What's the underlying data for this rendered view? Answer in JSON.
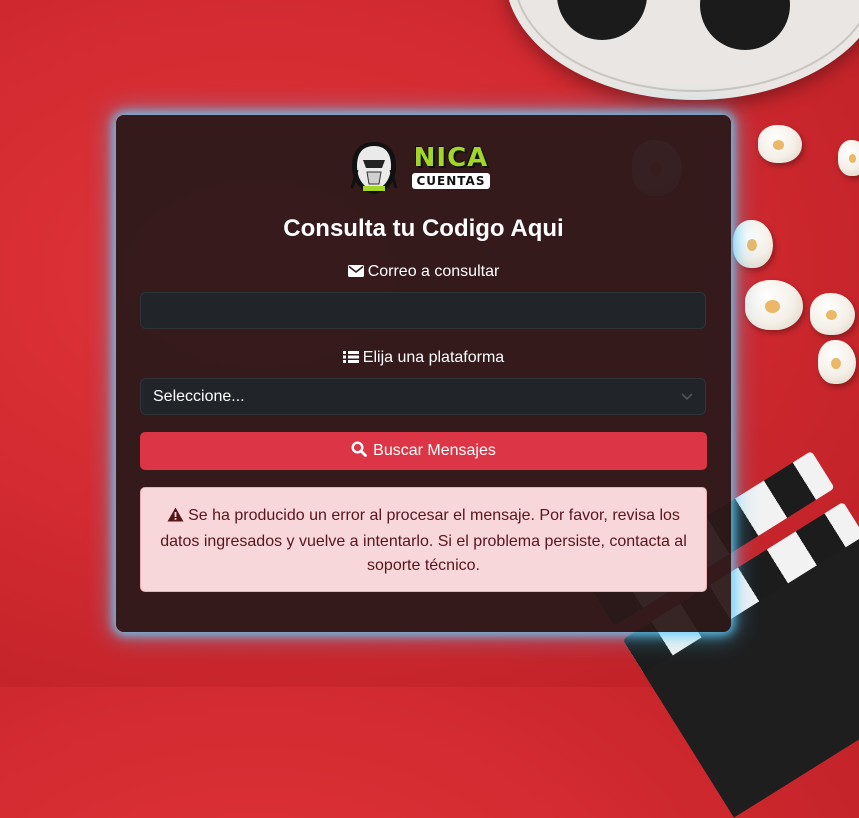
{
  "logo": {
    "line1": "NICA",
    "line2": "CUENTAS"
  },
  "form": {
    "title": "Consulta tu Codigo Aqui",
    "email_label": "Correo a consultar",
    "email_value": "",
    "platform_label": "Elija una plataforma",
    "platform_selected": "Seleccione...",
    "search_button": "Buscar Mensajes"
  },
  "alert": {
    "message": "Se ha producido un error al procesar el mensaje. Por favor, revisa los datos ingresados y vuelve a intentarlo. Si el problema persiste, contacta al soporte técnico."
  },
  "icons": {
    "email": "envelope-icon",
    "platform": "list-icon",
    "search": "search-icon",
    "alert": "warning-icon"
  },
  "colors": {
    "background": "#d32b31",
    "card": "#2c191a",
    "glow": "#66d2ff",
    "button": "#dc3545",
    "alert_bg": "#f8d7da",
    "alert_text": "#58151c",
    "logo_green": "#a4d62a"
  }
}
